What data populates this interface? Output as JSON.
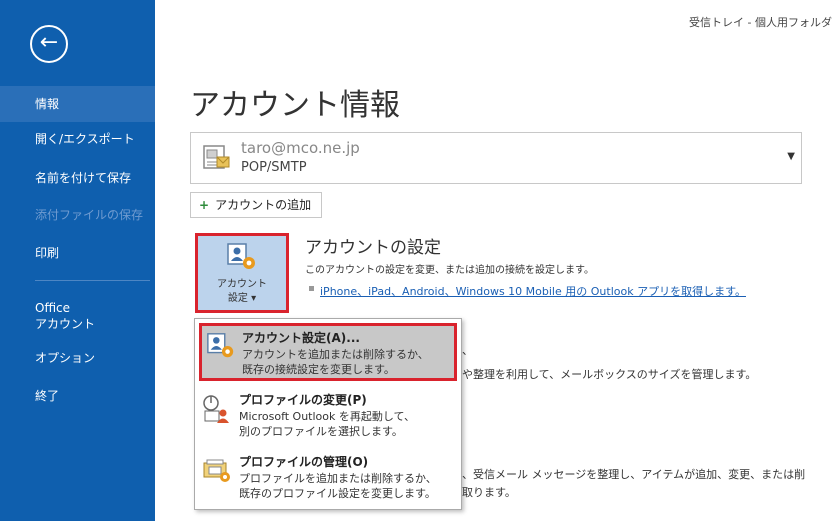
{
  "status": {
    "folder": "受信トレイ - 個人用フォルダ"
  },
  "sidebar": {
    "items": [
      {
        "label": "情報"
      },
      {
        "label": "開く/エクスポート"
      },
      {
        "label": "名前を付けて保存"
      },
      {
        "label": "添付ファイルの保存"
      },
      {
        "label": "印刷"
      },
      {
        "label": "Office"
      },
      {
        "label": "アカウント"
      },
      {
        "label": "オプション"
      },
      {
        "label": "終了"
      }
    ]
  },
  "main": {
    "title": "アカウント情報",
    "account": {
      "email": "taro@mco.ne.jp",
      "type": "POP/SMTP"
    },
    "add_account": "アカウントの追加",
    "settings_button": {
      "line1": "アカウント",
      "line2": "設定 ▾"
    },
    "section": {
      "title": "アカウントの設定",
      "desc": "このアカウントの設定を変更、または追加の接続を設定します。",
      "link": "iPhone、iPad、Android、Windows 10 Mobile 用の Outlook アプリを取得します。"
    },
    "behind_text": {
      "line_a": "、",
      "line_b": "や整理を利用して、メールボックスのサイズを管理します。",
      "line_c": "、受信メール メッセージを整理し、アイテムが追加、変更、または削",
      "line_d": "取ります。"
    }
  },
  "menu": {
    "items": [
      {
        "title": "アカウント設定(A)...",
        "desc1": "アカウントを追加または削除するか、",
        "desc2": "既存の接続設定を変更します。"
      },
      {
        "title": "プロファイルの変更(P)",
        "desc1": "Microsoft Outlook を再起動して、",
        "desc2": "別のプロファイルを選択します。"
      },
      {
        "title": "プロファイルの管理(O)",
        "desc1": "プロファイルを追加または削除するか、",
        "desc2": "既存のプロファイル設定を変更します。"
      }
    ]
  }
}
